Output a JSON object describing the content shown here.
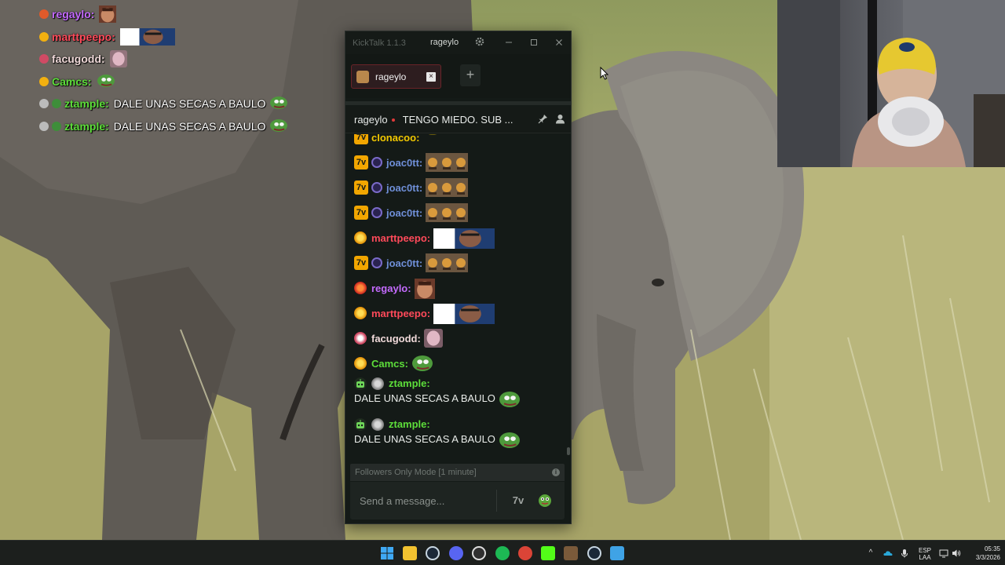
{
  "overlay_chat": [
    {
      "user": "regaylo",
      "user_color": "#c56bff",
      "badge_color": "#e05a2a",
      "message": "",
      "emote": "face"
    },
    {
      "user": "marttpeepo",
      "user_color": "#ff4a5a",
      "badge_color": "#f2b010",
      "message": "",
      "emote": "photo"
    },
    {
      "user": "facugodd",
      "user_color": "#f0d9d9",
      "badge_color": "#d04a64",
      "message": "",
      "emote": "blur"
    },
    {
      "user": "Camcs",
      "user_color": "#5dde3a",
      "badge_color": "#f2b010",
      "message": "",
      "emote": "pepe"
    },
    {
      "user": "ztample",
      "user_color": "#5dde3a",
      "badge_color": "#3e8e3a",
      "message": "DALE UNAS SECAS A BAULO",
      "emote": "pepe"
    },
    {
      "user": "ztample",
      "user_color": "#5dde3a",
      "badge_color": "#3e8e3a",
      "message": "DALE UNAS SECAS A BAULO",
      "emote": "pepe"
    }
  ],
  "window": {
    "app_title": "KickTalk 1.1.3",
    "title_user": "rageylo",
    "settings_icon": "gear-icon",
    "minimize_icon": "minimize-icon",
    "maximize_icon": "maximize-icon",
    "close_icon": "close-icon"
  },
  "tab": {
    "label": "rageylo",
    "close": "×",
    "add": "+"
  },
  "stream_header": {
    "user": "rageylo",
    "title": "TENGO MIEDO. SUB ..."
  },
  "messages": [
    {
      "user": "clonacoo",
      "user_color": "#f2c800",
      "badges": [
        "7tv"
      ],
      "emote": "cut",
      "text": ""
    },
    {
      "user": "joac0tt",
      "user_color": "#6f8fd8",
      "badges": [
        "7tv",
        "sub-blue"
      ],
      "emote": "triple",
      "text": ""
    },
    {
      "user": "joac0tt",
      "user_color": "#6f8fd8",
      "badges": [
        "7tv",
        "sub-blue"
      ],
      "emote": "triple",
      "text": ""
    },
    {
      "user": "joac0tt",
      "user_color": "#6f8fd8",
      "badges": [
        "7tv",
        "sub-blue"
      ],
      "emote": "triple",
      "text": ""
    },
    {
      "user": "marttpeepo",
      "user_color": "#ff4a5a",
      "badges": [
        "sub-gold"
      ],
      "emote": "photo",
      "text": ""
    },
    {
      "user": "joac0tt",
      "user_color": "#6f8fd8",
      "badges": [
        "7tv",
        "sub-blue"
      ],
      "emote": "triple",
      "text": ""
    },
    {
      "user": "regaylo",
      "user_color": "#c56bff",
      "badges": [
        "sub-red"
      ],
      "emote": "face",
      "text": ""
    },
    {
      "user": "marttpeepo",
      "user_color": "#ff4a5a",
      "badges": [
        "sub-gold"
      ],
      "emote": "photo",
      "text": ""
    },
    {
      "user": "facugodd",
      "user_color": "#f0d9d9",
      "badges": [
        "sub-pink"
      ],
      "emote": "blur",
      "text": ""
    },
    {
      "user": "Camcs",
      "user_color": "#5dde3a",
      "badges": [
        "sub-gold"
      ],
      "emote": "pepe",
      "text": ""
    },
    {
      "user": "ztample",
      "user_color": "#5dde3a",
      "badges": [
        "bot",
        "sub-gray"
      ],
      "emote": "pepe",
      "text": "DALE UNAS SECAS A BAULO"
    },
    {
      "user": "ztample",
      "user_color": "#5dde3a",
      "badges": [
        "bot",
        "sub-gray"
      ],
      "emote": "pepe",
      "text": "DALE UNAS SECAS A BAULO"
    }
  ],
  "input": {
    "followers_notice": "Followers Only Mode [1 minute]",
    "placeholder": "Send a message...",
    "emote_7tv_label": "7v"
  },
  "taskbar": {
    "apps": [
      "windows-start",
      "file-explorer",
      "steam",
      "discord",
      "obs",
      "spotify",
      "chrome",
      "kick",
      "minecraft",
      "steam-2",
      "notepad"
    ],
    "tray_lang_top": "ESP",
    "tray_lang_bottom": "LAA",
    "time": "05:35",
    "date": "3/3/2026",
    "tray_caret": "^"
  },
  "colors": {
    "accent_red": "#6a2428",
    "kick_green": "#53fc18",
    "window_bg": "#141a17"
  }
}
